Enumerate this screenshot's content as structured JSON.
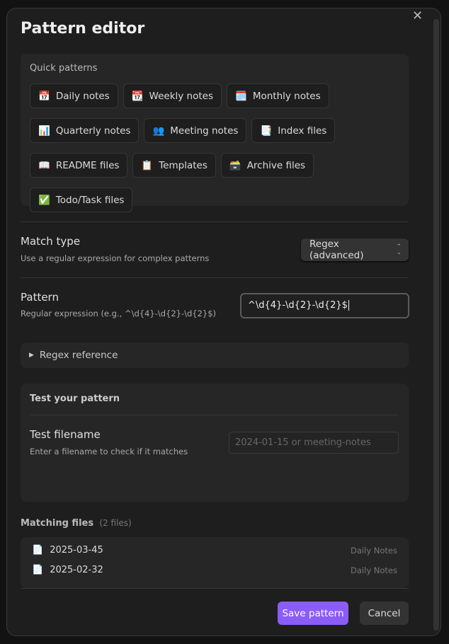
{
  "title": "Pattern editor",
  "quick_patterns": {
    "title": "Quick patterns",
    "items": [
      {
        "icon": "📅",
        "label": "Daily notes"
      },
      {
        "icon": "📆",
        "label": "Weekly notes"
      },
      {
        "icon": "🗓️",
        "label": "Monthly notes"
      },
      {
        "icon": "📊",
        "label": "Quarterly notes"
      },
      {
        "icon": "👥",
        "label": "Meeting notes"
      },
      {
        "icon": "📑",
        "label": "Index files"
      },
      {
        "icon": "📖",
        "label": "README files"
      },
      {
        "icon": "📋",
        "label": "Templates"
      },
      {
        "icon": "🗃️",
        "label": "Archive files"
      },
      {
        "icon": "✅",
        "label": "Todo/Task files"
      }
    ]
  },
  "match_type": {
    "label": "Match type",
    "description": "Use a regular expression for complex patterns",
    "value": "Regex (advanced)"
  },
  "pattern": {
    "label": "Pattern",
    "description": "Regular expression (e.g., ^\\d{4}-\\d{2}-\\d{2}$)",
    "value": "^\\d{4}-\\d{2}-\\d{2}$"
  },
  "regex_reference": "Regex reference",
  "test": {
    "title": "Test your pattern",
    "label": "Test filename",
    "description": "Enter a filename to check if it matches",
    "placeholder": "2024-01-15 or meeting-notes"
  },
  "matching": {
    "label": "Matching files",
    "count": "(2 files)",
    "files": [
      {
        "name": "2025-03-45",
        "folder": "Daily Notes"
      },
      {
        "name": "2025-02-32",
        "folder": "Daily Notes"
      }
    ]
  },
  "buttons": {
    "save": "Save pattern",
    "cancel": "Cancel"
  },
  "colors": {
    "accent": "#8b5cf6"
  }
}
